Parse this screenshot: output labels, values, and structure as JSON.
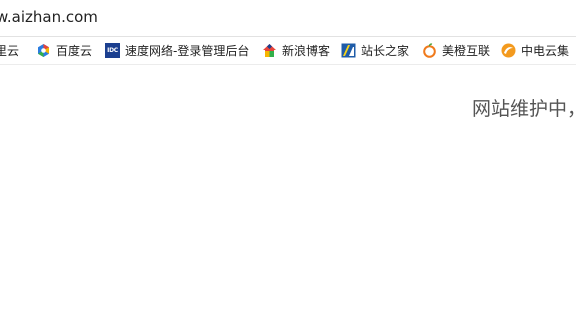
{
  "address_bar": {
    "url": "w.aizhan.com"
  },
  "bookmarks": [
    {
      "label": "里云",
      "icon": "aliyun-icon"
    },
    {
      "label": "百度云",
      "icon": "baidu-cloud-icon"
    },
    {
      "label": "速度网络-登录管理后台",
      "icon": "idc-icon",
      "icon_text": "IDC"
    },
    {
      "label": "新浪博客",
      "icon": "sina-blog-icon"
    },
    {
      "label": "站长之家",
      "icon": "chinaz-icon"
    },
    {
      "label": "美橙互联",
      "icon": "orange-icon"
    },
    {
      "label": "中电云集",
      "icon": "zhongdian-icon"
    }
  ],
  "content": {
    "message": "网站维护中，"
  }
}
